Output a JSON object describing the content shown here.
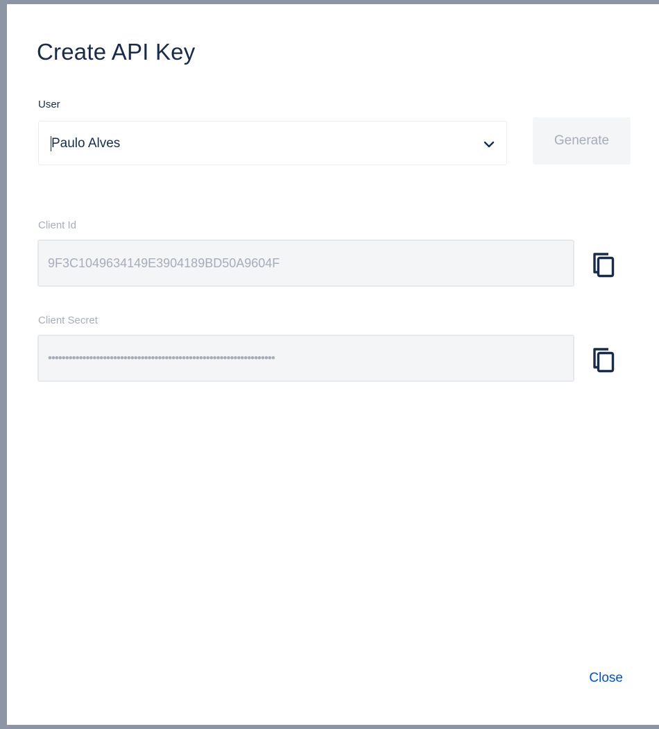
{
  "dialog": {
    "title": "Create API Key",
    "user_label": "User",
    "user_value": "Paulo Alves",
    "generate_label": "Generate",
    "client_id_label": "Client Id",
    "client_id_value": "9F3C1049634149E3904189BD50A9604F",
    "client_secret_label": "Client Secret",
    "client_secret_value": "••••••••••••••••••••••••••••••••••••••••••••••••••••••••••••••••••",
    "close_label": "Close"
  },
  "icons": {
    "chevron": "chevron-down-icon",
    "copy": "copy-icon"
  },
  "colors": {
    "text": "#172b4d",
    "muted": "#a5adba",
    "link": "#0052cc",
    "field_bg": "#f4f5f7",
    "backdrop": "#8b95a4"
  }
}
